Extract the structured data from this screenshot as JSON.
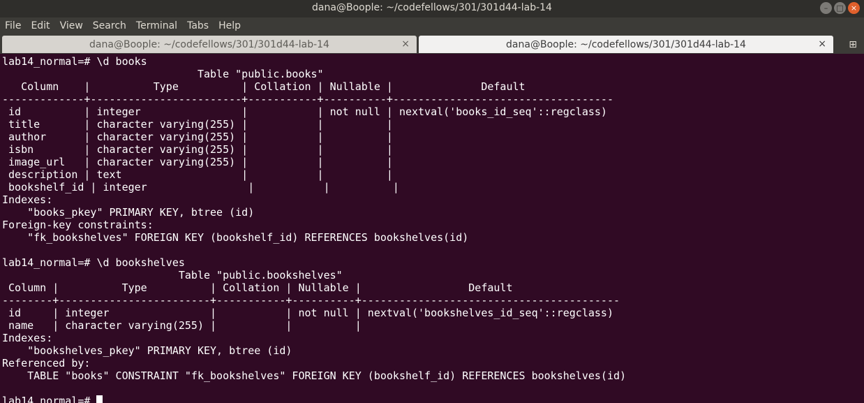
{
  "window": {
    "title": "dana@Boople: ~/codefellows/301/301d44-lab-14",
    "controls": [
      "minimize",
      "maximize",
      "close"
    ]
  },
  "menu": [
    "File",
    "Edit",
    "View",
    "Search",
    "Terminal",
    "Tabs",
    "Help"
  ],
  "tabs": [
    {
      "label": "dana@Boople: ~/codefellows/301/301d44-lab-14",
      "close": "×",
      "active": false
    },
    {
      "label": "dana@Boople: ~/codefellows/301/301d44-lab-14",
      "close": "×",
      "active": true
    }
  ],
  "new_tab_glyph": "⊞",
  "terminal": {
    "lines": [
      "lab14_normal=# \\d books",
      "                               Table \"public.books\"",
      "   Column    |          Type          | Collation | Nullable |              Default",
      "-------------+------------------------+-----------+----------+-----------------------------------",
      " id          | integer                |           | not null | nextval('books_id_seq'::regclass)",
      " title       | character varying(255) |           |          |",
      " author      | character varying(255) |           |          |",
      " isbn        | character varying(255) |           |          |",
      " image_url   | character varying(255) |           |          |",
      " description | text                   |           |          |",
      " bookshelf_id | integer                |           |          |",
      "Indexes:",
      "    \"books_pkey\" PRIMARY KEY, btree (id)",
      "Foreign-key constraints:",
      "    \"fk_bookshelves\" FOREIGN KEY (bookshelf_id) REFERENCES bookshelves(id)",
      "",
      "lab14_normal=# \\d bookshelves",
      "                            Table \"public.bookshelves\"",
      " Column |          Type          | Collation | Nullable |                 Default",
      "--------+------------------------+-----------+----------+-----------------------------------------",
      " id     | integer                |           | not null | nextval('bookshelves_id_seq'::regclass)",
      " name   | character varying(255) |           |          |",
      "Indexes:",
      "    \"bookshelves_pkey\" PRIMARY KEY, btree (id)",
      "Referenced by:",
      "    TABLE \"books\" CONSTRAINT \"fk_bookshelves\" FOREIGN KEY (bookshelf_id) REFERENCES bookshelves(id)",
      ""
    ],
    "prompt": "lab14_normal=# "
  },
  "colors": {
    "terminal_bg": "#300a24",
    "terminal_fg": "#ffffff",
    "titlebar_bg": "#2f2e2b",
    "menubar_bg": "#3c3b37",
    "close_button": "#e0602c"
  }
}
